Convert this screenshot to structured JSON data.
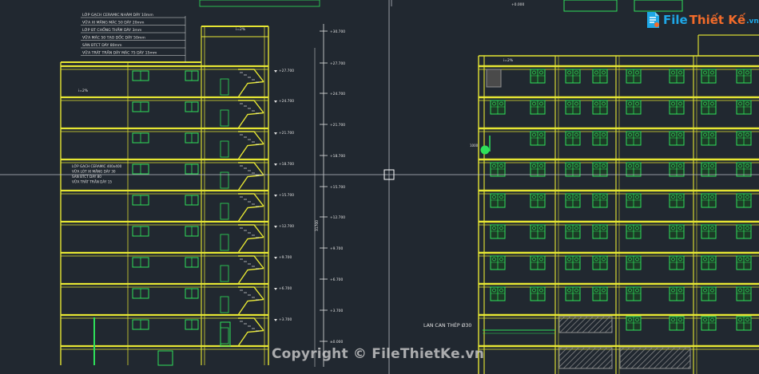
{
  "colors": {
    "background": "#212830",
    "floor": "#e6e633",
    "outline": "#d8d832",
    "window": "#2ee05a",
    "stair": "#ffffff",
    "text_small": "#e0e0e0",
    "crosshair": "#b8bcc4",
    "hatch": "#909090",
    "logo_blue": "#1ea7e6",
    "logo_orange": "#f26b2a"
  },
  "logo": {
    "file": "File",
    "thietke": "Thiết Kế",
    "vn": ".vn",
    "icon": "logo-mark-icon"
  },
  "watermark": "Copyright © FileThietKe.vn",
  "notes": {
    "roof_layers": [
      "LỚP GẠCH CERAMIC NHÁM DÀY 10mm",
      "VỮA XI MĂNG MÁC 50 DÀY 20mm",
      "LỚP BT CHỐNG THẤM DÀY 3mm",
      "VỮA MÁC 50 TẠO DỐC DÀY 50mm",
      "SÀN BTCT DÀY 80mm",
      "VỮA TRÁT TRẦN DÀY MÁC 75 DÀY 15mm"
    ],
    "floor_layers": [
      "LỚP GẠCH CERAMIC 400x400",
      "VỮA LÓT XI MĂNG DÀY 30",
      "SÀN BTCT DÀY 80",
      "VỮA TRÁT TRẦN DÀY 15"
    ],
    "railing_label": "LAN CAN THÉP Ø30"
  },
  "levels": [
    "+30.700",
    "+27.700",
    "+24.700",
    "+21.700",
    "+18.700",
    "+15.700",
    "+12.700",
    "+9.700",
    "+6.700",
    "+3.700",
    "±0.000"
  ],
  "small_marks": {
    "roof_pct": "i=2%",
    "floor_pct": "i=2%",
    "total_height": "31700",
    "elev_dim": "1000",
    "top_level": "+0.000"
  }
}
